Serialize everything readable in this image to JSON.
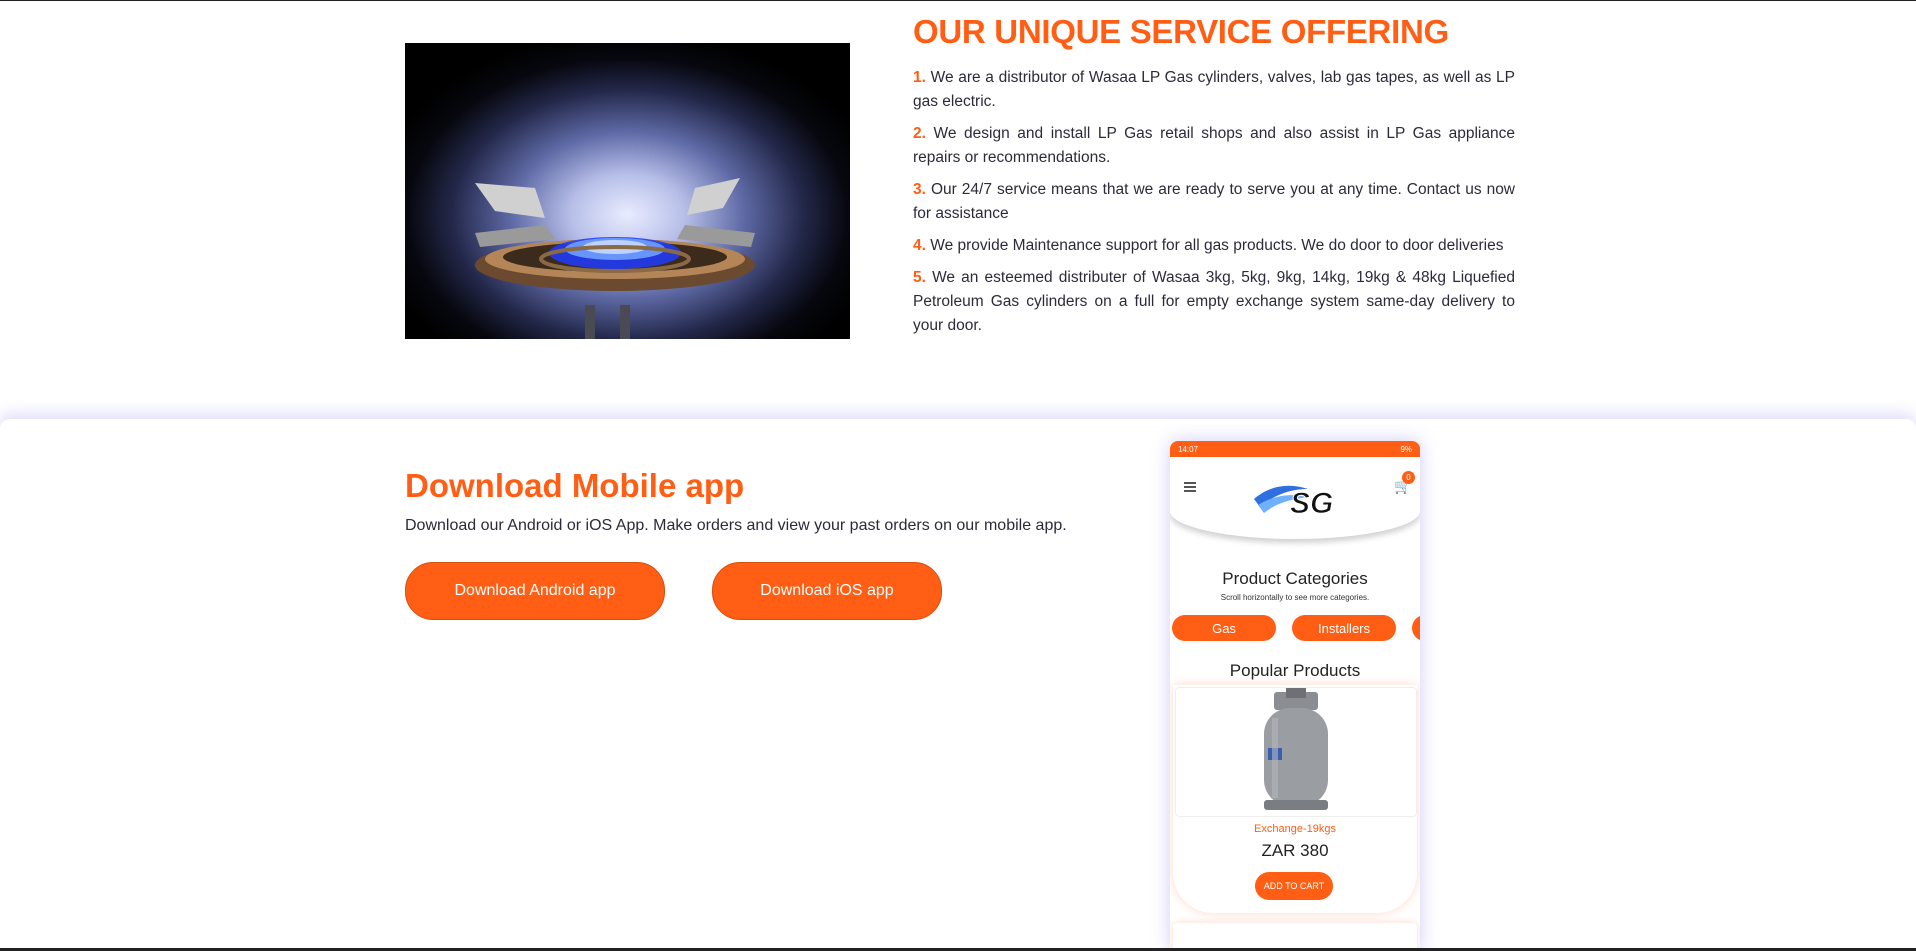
{
  "service": {
    "title": "OUR UNIQUE SERVICE OFFERING",
    "items": [
      {
        "num": "1.",
        "text": "We are a distributor of Wasaa LP Gas cylinders, valves, lab gas tapes, as well as LP gas electric."
      },
      {
        "num": "2.",
        "text": "We design and install LP Gas retail shops and also assist in LP Gas appliance repairs or recommendations."
      },
      {
        "num": "3.",
        "text": "Our 24/7 service means that we are ready to serve you at any time. Contact us now for assistance"
      },
      {
        "num": "4.",
        "text": "We provide Maintenance support for all gas products. We do door to door deliveries"
      },
      {
        "num": "5.",
        "text": "We an esteemed distributer of Wasaa 3kg, 5kg, 9kg, 14kg, 19kg & 48kg Liquefied Petroleum Gas cylinders on a full for empty exchange system same-day delivery to your door."
      }
    ]
  },
  "app": {
    "title": "Download Mobile app",
    "subtitle": "Download our Android or iOS App. Make orders and view your past orders on our mobile app.",
    "android_button": "Download Android app",
    "ios_button": "Download iOS app"
  },
  "phone": {
    "status_time": "14:07",
    "status_battery": "9%",
    "logo_text": "SG",
    "cart_count": "0",
    "categories_title": "Product Categories",
    "categories_hint": "Scroll horizontally to see more categories.",
    "categories": [
      "Gas",
      "Installers"
    ],
    "popular_title": "Popular Products",
    "product": {
      "name": "Exchange-19kgs",
      "price": "ZAR 380",
      "add_to_cart": "ADD TO CART"
    }
  },
  "colors": {
    "accent": "#ff5e14",
    "text": "#2b2b3a"
  }
}
